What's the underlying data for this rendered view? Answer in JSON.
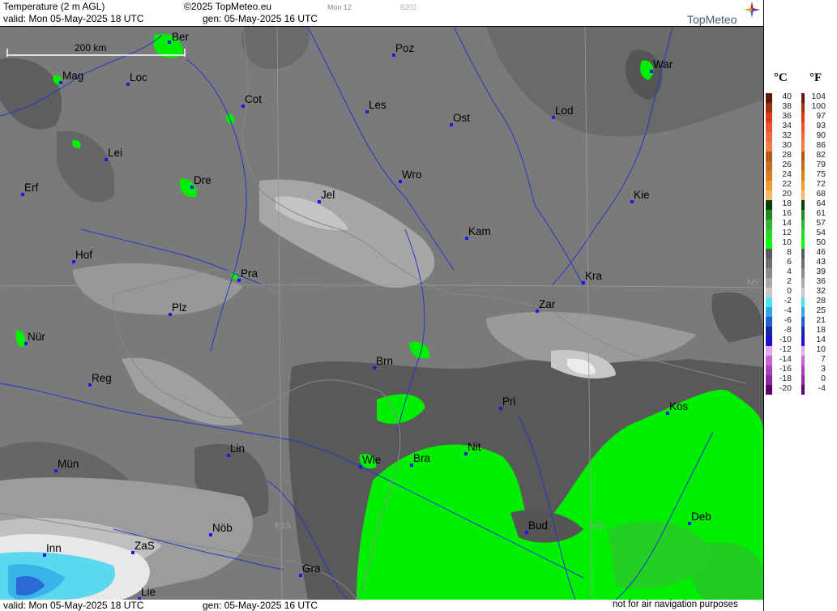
{
  "header": {
    "product": "Temperature (2 m AGL)",
    "valid": "valid:  Mon  05-May-2025  18 UTC",
    "copyright": "©2025 TopMeteo.eu",
    "gen": "gen:  05-May-2025 16 UTC",
    "day_code": "Mon 12",
    "code": "8202",
    "logo": "TopMeteo"
  },
  "footer": {
    "valid": "valid:  Mon  05-May-2025  18 UTC",
    "gen": "gen:  05-May-2025 16 UTC",
    "disclaimer": "not for air navigation purposes"
  },
  "scale_bar": {
    "label": "200 km"
  },
  "grid_labels": {
    "n50_left": "N50",
    "n50_right": "N5",
    "e15": "E15",
    "e20": "E20"
  },
  "cities": [
    {
      "name": "Ber",
      "id": "berlin"
    },
    {
      "name": "Poz",
      "id": "poznan"
    },
    {
      "name": "War",
      "id": "warsaw"
    },
    {
      "name": "Mag",
      "id": "magdeburg"
    },
    {
      "name": "Loc",
      "id": "loc"
    },
    {
      "name": "Cot",
      "id": "cottbus"
    },
    {
      "name": "Les",
      "id": "leszno"
    },
    {
      "name": "Ost",
      "id": "ostrow"
    },
    {
      "name": "Lod",
      "id": "lodz"
    },
    {
      "name": "Lei",
      "id": "leipzig"
    },
    {
      "name": "Dre",
      "id": "dresden"
    },
    {
      "name": "Wro",
      "id": "wroclaw"
    },
    {
      "name": "Erf",
      "id": "erfurt"
    },
    {
      "name": "Jel",
      "id": "jelenia"
    },
    {
      "name": "Kie",
      "id": "kielce"
    },
    {
      "name": "Kam",
      "id": "kam"
    },
    {
      "name": "Hof",
      "id": "hof"
    },
    {
      "name": "Pra",
      "id": "prague"
    },
    {
      "name": "Kra",
      "id": "krakow"
    },
    {
      "name": "Zar",
      "id": "zar"
    },
    {
      "name": "Plz",
      "id": "plzen"
    },
    {
      "name": "Nür",
      "id": "nuernberg"
    },
    {
      "name": "Brn",
      "id": "brno"
    },
    {
      "name": "Reg",
      "id": "regensburg"
    },
    {
      "name": "Pri",
      "id": "prievidza"
    },
    {
      "name": "Kos",
      "id": "kosice"
    },
    {
      "name": "Lin",
      "id": "linz"
    },
    {
      "name": "Nit",
      "id": "nitra"
    },
    {
      "name": "Wie",
      "id": "vienna"
    },
    {
      "name": "Bra",
      "id": "bratislava"
    },
    {
      "name": "Mün",
      "id": "muenchen"
    },
    {
      "name": "Bud",
      "id": "budapest"
    },
    {
      "name": "Deb",
      "id": "debrecen"
    },
    {
      "name": "Nöb",
      "id": "noeb"
    },
    {
      "name": "ZaS",
      "id": "zas"
    },
    {
      "name": "Inn",
      "id": "innsbruck"
    },
    {
      "name": "Gra",
      "id": "graz"
    },
    {
      "name": "Lie",
      "id": "lienz"
    }
  ],
  "legend": {
    "unit_c": "°C",
    "unit_f": "°F",
    "celsius": [
      "40",
      "38",
      "36",
      "34",
      "32",
      "30",
      "28",
      "26",
      "24",
      "22",
      "20",
      "18",
      "16",
      "14",
      "12",
      "10",
      "8",
      "6",
      "4",
      "2",
      "0",
      "-2",
      "-4",
      "-6",
      "-8",
      "-10",
      "-12",
      "-14",
      "-16",
      "-18",
      "-20"
    ],
    "fahrenheit": [
      "104",
      "100",
      "97",
      "93",
      "90",
      "86",
      "82",
      "79",
      "75",
      "72",
      "68",
      "64",
      "61",
      "57",
      "54",
      "50",
      "46",
      "43",
      "39",
      "36",
      "32",
      "28",
      "25",
      "21",
      "18",
      "14",
      "10",
      "7",
      "3",
      "0",
      "-4"
    ],
    "colors": [
      "#5c1a00",
      "#a0300e",
      "#d73a16",
      "#e8552c",
      "#ef6a3a",
      "#f2803e",
      "#b45a1c",
      "#c86e1e",
      "#e07e1e",
      "#f09a30",
      "#f6b860",
      "#064006",
      "#1f8a1f",
      "#34b534",
      "#2ed32e",
      "#00ff00",
      "#5a5a5a",
      "#6e6e6e",
      "#8a8a8a",
      "#a8a8a8",
      "#c8c8c8",
      "#50e0f0",
      "#30a8e8",
      "#2060d0",
      "#1428a8",
      "#2010d0",
      "#e0a8ee",
      "#d060d8",
      "#b040c0",
      "#8a2aa0",
      "#600070"
    ]
  }
}
